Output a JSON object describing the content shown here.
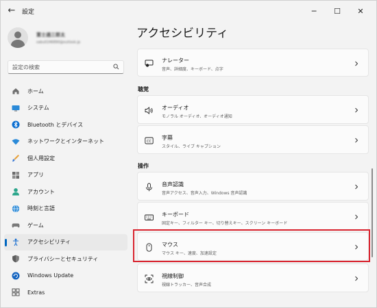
{
  "window": {
    "title": "設定",
    "back_glyph": "←",
    "minimize_glyph": "─",
    "maximize_glyph": "☐",
    "close_glyph": "✕"
  },
  "profile": {
    "name": "富士通三郎太",
    "email": "sabu0246890@outlook.jp"
  },
  "search": {
    "placeholder": "設定の検索"
  },
  "nav": {
    "items": [
      {
        "label": "ホーム",
        "icon": "home-icon"
      },
      {
        "label": "システム",
        "icon": "monitor-icon"
      },
      {
        "label": "Bluetooth とデバイス",
        "icon": "bluetooth-icon"
      },
      {
        "label": "ネットワークとインターネット",
        "icon": "wifi-icon"
      },
      {
        "label": "個人用設定",
        "icon": "brush-icon"
      },
      {
        "label": "アプリ",
        "icon": "apps-icon"
      },
      {
        "label": "アカウント",
        "icon": "account-icon"
      },
      {
        "label": "時刻と言語",
        "icon": "globe-clock-icon"
      },
      {
        "label": "ゲーム",
        "icon": "gamepad-icon"
      },
      {
        "label": "アクセシビリティ",
        "icon": "accessibility-icon",
        "selected": true
      },
      {
        "label": "プライバシーとセキュリティ",
        "icon": "shield-icon"
      },
      {
        "label": "Windows Update",
        "icon": "update-icon"
      },
      {
        "label": "Extras",
        "icon": "extras-icon"
      }
    ]
  },
  "main": {
    "title": "アクセシビリティ",
    "cards": [
      {
        "title": "ナレーター",
        "subtitle": "音声、詳細度、キーボード、点字",
        "icon": "narrator-icon"
      },
      {
        "title": "オーディオ",
        "subtitle": "モノラル オーディオ、オーディオ通知",
        "icon": "speaker-icon"
      },
      {
        "title": "字幕",
        "subtitle": "スタイル、ライブ キャプション",
        "icon": "captions-icon"
      },
      {
        "title": "音声認識",
        "subtitle": "音声アクセス、音声入力、Windows 音声認識",
        "icon": "microphone-icon"
      },
      {
        "title": "キーボード",
        "subtitle": "固定キー、フィルター キー、切り替えキー、スクリーン キーボード",
        "icon": "keyboard-icon"
      },
      {
        "title": "マウス",
        "subtitle": "マウス キー、速度、加速設定",
        "icon": "mouse-icon"
      },
      {
        "title": "視線制御",
        "subtitle": "視線トラッカー、音声合成",
        "icon": "eye-control-icon"
      }
    ],
    "sections": {
      "hearing": "聴覚",
      "interaction": "操作"
    }
  },
  "colors": {
    "accent": "#0067c0",
    "highlight": "#d9232e"
  }
}
